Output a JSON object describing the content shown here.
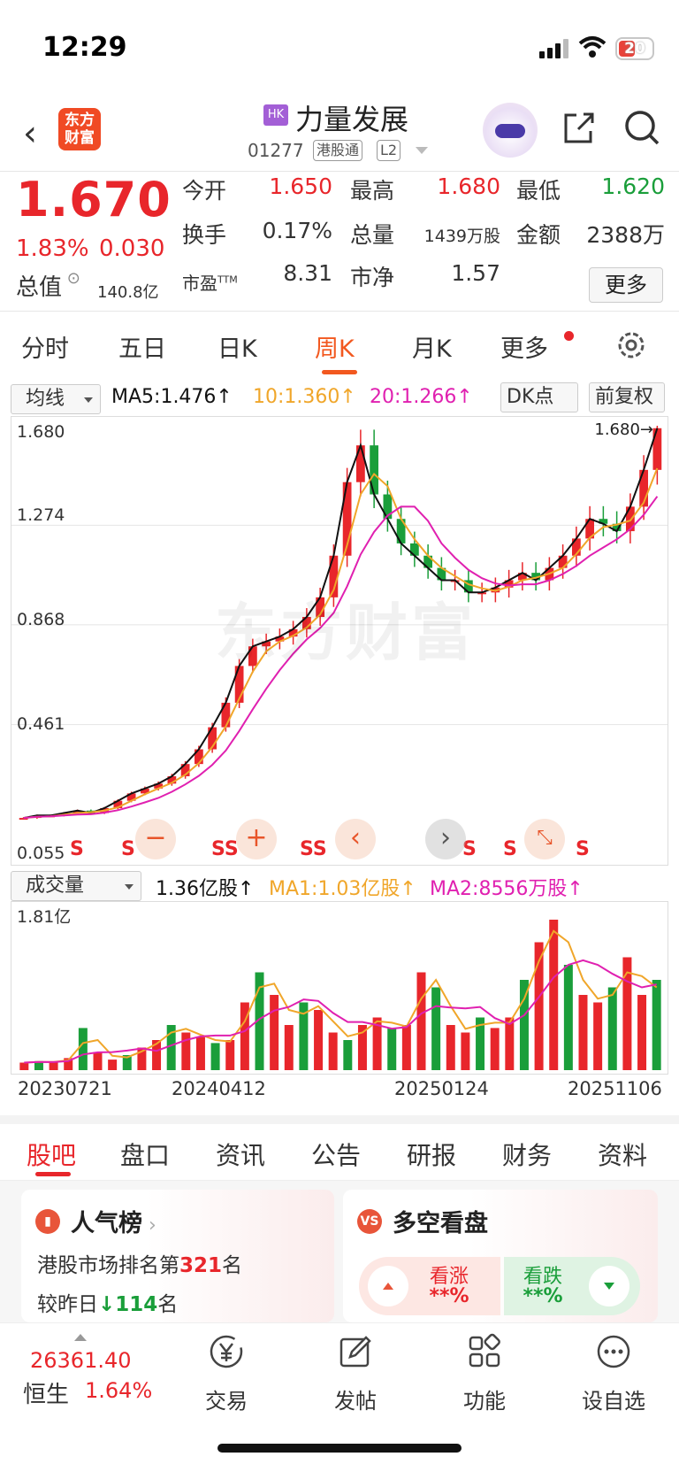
{
  "status_bar": {
    "time": "12:29",
    "battery": "20"
  },
  "header": {
    "logo_text": "东方财富",
    "market_badge": "HK",
    "stock_name": "力量发展",
    "stock_code": "01277",
    "tag_connect": "港股通",
    "tag_level": "L2"
  },
  "quote": {
    "price": "1.670",
    "change_pct": "1.83%",
    "change": "0.030",
    "market_cap_label": "总值",
    "market_cap_value": "140.8亿",
    "open_label": "今开",
    "open": "1.650",
    "high_label": "最高",
    "high": "1.680",
    "low_label": "最低",
    "low": "1.620",
    "turnover_label": "换手",
    "turnover": "0.17%",
    "volume_label": "总量",
    "volume": "1439万股",
    "amount_label": "金额",
    "amount": "2388万",
    "pe_label": "市盈",
    "pe_sup": "TTM",
    "pe": "8.31",
    "pb_label": "市净",
    "pb": "1.57",
    "more_button": "更多",
    "colors": {
      "up": "#e8262b",
      "down": "#1a9e3a"
    }
  },
  "tabs": [
    "分时",
    "五日",
    "日K",
    "周K",
    "月K",
    "更多"
  ],
  "active_tab": "周K",
  "ma_bar": {
    "select": "均线",
    "ma5": "MA5:1.476↑",
    "ma10": "10:1.360↑",
    "ma20": "20:1.266↑",
    "dk_button": "DK点",
    "adjust_button": "前复权",
    "colors": {
      "ma5": "#111111",
      "ma10": "#f0a62a",
      "ma20": "#e020b0"
    }
  },
  "vol_bar": {
    "select": "成交量",
    "vol": "1.36亿股↑",
    "ma1": "MA1:1.03亿股↑",
    "ma2": "MA2:8556万股↑"
  },
  "chart_data": [
    {
      "type": "candlestick",
      "title": "周K",
      "y_ticks": [
        "1.680",
        "1.274",
        "0.868",
        "0.461",
        "0.055"
      ],
      "ylim": [
        0.055,
        1.68
      ],
      "last_price_label": "1.680→",
      "watermark": "东方财富",
      "signal_marks": [
        "S",
        "S",
        "SS",
        "SS",
        "S",
        "S",
        "S"
      ],
      "x_dates": [
        "20230721",
        "20240412",
        "20250124",
        "20251106"
      ],
      "close_trend": [
        0.08,
        0.09,
        0.09,
        0.1,
        0.11,
        0.1,
        0.12,
        0.15,
        0.18,
        0.2,
        0.22,
        0.25,
        0.3,
        0.36,
        0.45,
        0.55,
        0.7,
        0.78,
        0.8,
        0.82,
        0.85,
        0.9,
        0.98,
        1.15,
        1.45,
        1.6,
        1.4,
        1.3,
        1.2,
        1.15,
        1.1,
        1.05,
        1.05,
        1.0,
        1.0,
        1.02,
        1.05,
        1.08,
        1.05,
        1.1,
        1.15,
        1.22,
        1.3,
        1.28,
        1.25,
        1.35,
        1.5,
        1.67
      ]
    },
    {
      "type": "bar",
      "title": "成交量",
      "y_max_label": "1.81亿",
      "values_rel": [
        0.05,
        0.06,
        0.05,
        0.08,
        0.28,
        0.12,
        0.07,
        0.1,
        0.15,
        0.2,
        0.3,
        0.25,
        0.22,
        0.18,
        0.2,
        0.45,
        0.65,
        0.5,
        0.3,
        0.45,
        0.4,
        0.25,
        0.2,
        0.3,
        0.35,
        0.28,
        0.3,
        0.65,
        0.55,
        0.3,
        0.25,
        0.35,
        0.28,
        0.35,
        0.6,
        0.85,
        1.0,
        0.7,
        0.5,
        0.45,
        0.55,
        0.75,
        0.5,
        0.6
      ]
    }
  ],
  "chart_controls": {
    "zoom_out": "−",
    "zoom_in": "+",
    "prev": "‹",
    "next": "›"
  },
  "bottom_tabs": [
    "股吧",
    "盘口",
    "资讯",
    "公告",
    "研报",
    "财务",
    "资料"
  ],
  "active_bottom_tab": "股吧",
  "cards": {
    "popularity": {
      "title": "人气榜",
      "rank_prefix": "港股市场排名第",
      "rank": "321",
      "rank_suffix": "名",
      "yest_prefix": "较昨日",
      "yest_change": "↓114",
      "yest_suffix": "名"
    },
    "longshort": {
      "title": "多空看盘",
      "up_label": "看涨",
      "up_val": "**%",
      "down_label": "看跌",
      "down_val": "**%"
    }
  },
  "nav": {
    "index_value": "26361.40",
    "index_name": "恒生",
    "index_pct": "1.64%",
    "items": [
      "交易",
      "发帖",
      "功能",
      "设自选"
    ]
  }
}
